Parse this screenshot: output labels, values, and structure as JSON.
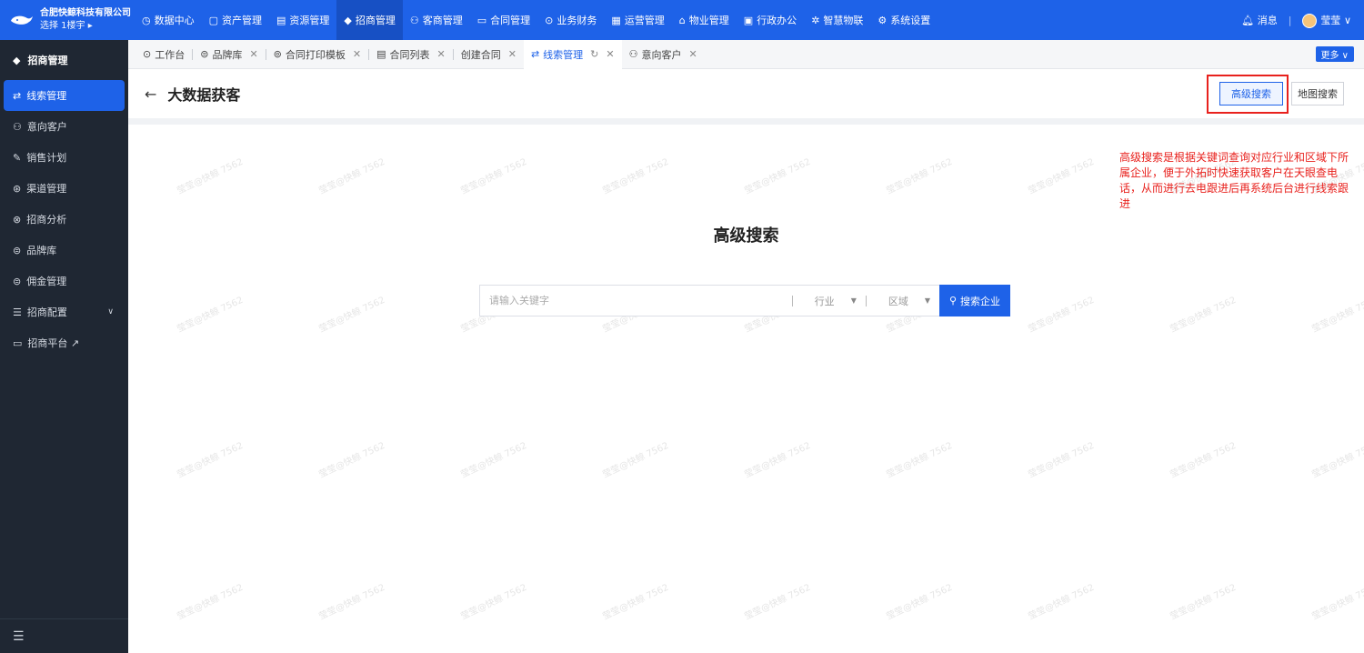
{
  "brand": {
    "company": "合肥快鲸科技有限公司",
    "selector": "选择 1楼宇 ▸"
  },
  "topnav": [
    {
      "icon": "◷",
      "label": "数据中心"
    },
    {
      "icon": "▢",
      "label": "资产管理"
    },
    {
      "icon": "▤",
      "label": "资源管理"
    },
    {
      "icon": "◆",
      "label": "招商管理"
    },
    {
      "icon": "⚇",
      "label": "客商管理"
    },
    {
      "icon": "▭",
      "label": "合同管理"
    },
    {
      "icon": "⊙",
      "label": "业务财务"
    },
    {
      "icon": "▦",
      "label": "运营管理"
    },
    {
      "icon": "⌂",
      "label": "物业管理"
    },
    {
      "icon": "▣",
      "label": "行政办公"
    },
    {
      "icon": "✲",
      "label": "智慧物联"
    },
    {
      "icon": "⚙",
      "label": "系统设置"
    }
  ],
  "topright": {
    "messages": "消息",
    "user": "莹莹"
  },
  "sidebar": {
    "header": "招商管理",
    "items": [
      {
        "icon": "⇄",
        "label": "线索管理"
      },
      {
        "icon": "⚇",
        "label": "意向客户"
      },
      {
        "icon": "✎",
        "label": "销售计划"
      },
      {
        "icon": "⊛",
        "label": "渠道管理"
      },
      {
        "icon": "⊗",
        "label": "招商分析"
      },
      {
        "icon": "⊜",
        "label": "品牌库"
      },
      {
        "icon": "⊜",
        "label": "佣金管理"
      },
      {
        "icon": "☰",
        "label": "招商配置"
      },
      {
        "icon": "▭",
        "label": "招商平台 ↗"
      }
    ],
    "collapse_icon": "☰"
  },
  "tabs": [
    {
      "icon": "⊙",
      "label": "工作台"
    },
    {
      "icon": "⊜",
      "label": "品牌库",
      "close": "✕"
    },
    {
      "icon": "⊚",
      "label": "合同打印模板",
      "close": "✕"
    },
    {
      "icon": "▤",
      "label": "合同列表",
      "close": "✕"
    },
    {
      "icon": "",
      "label": "创建合同",
      "close": "✕"
    },
    {
      "icon": "⇄",
      "label": "线索管理",
      "close": "✕",
      "refresh": "↻"
    },
    {
      "icon": "⚇",
      "label": "意向客户",
      "close": "✕"
    }
  ],
  "more": "更多 ∨",
  "page": {
    "back": "←",
    "title": "大数据获客",
    "btn_advanced": "高级搜索",
    "btn_map": "地图搜索"
  },
  "note": "高级搜索是根据关键词查询对应行业和区域下所属企业，便于外拓时快速获取客户在天眼查电话，从而进行去电跟进后再系统后台进行线索跟进",
  "search": {
    "title": "高级搜索",
    "placeholder": "请输入关键字",
    "industry": "行业",
    "region": "区域",
    "button": "搜索企业",
    "caret": "▼"
  },
  "watermark": "莹莹@快鲸 7562",
  "colors": {
    "primary": "#1e62e8",
    "sidebar": "#1f2733",
    "annotation": "#e8211d"
  }
}
